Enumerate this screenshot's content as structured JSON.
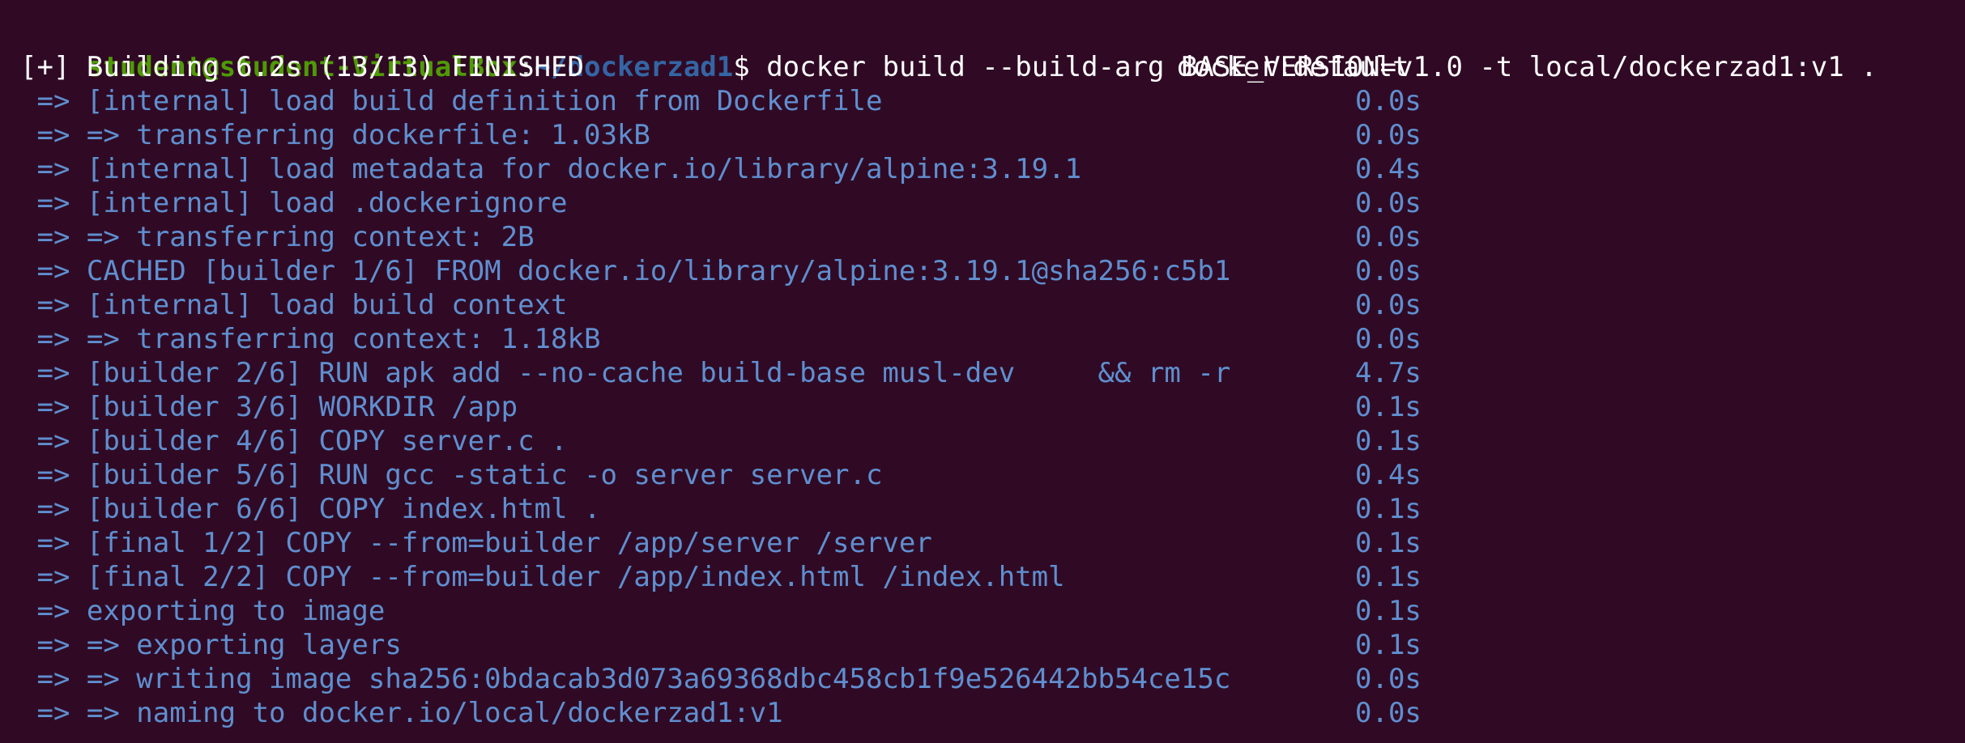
{
  "terminal": {
    "background": "#300a24",
    "prompt": {
      "user_host": "student@student-VirtualBox",
      "separator": ":",
      "path": "~/dockerzad1",
      "symbol": "$",
      "command": "docker build --build-arg BASE_VERSION=v1.0 -t local/dockerzad1:v1 ."
    },
    "header": {
      "status": "[+] Building 6.2s (13/13) FINISHED",
      "context": "docker:default"
    },
    "steps": [
      {
        "text": " => [internal] load build definition from Dockerfile",
        "time": "0.0s"
      },
      {
        "text": " => => transferring dockerfile: 1.03kB",
        "time": "0.0s"
      },
      {
        "text": " => [internal] load metadata for docker.io/library/alpine:3.19.1",
        "time": "0.4s"
      },
      {
        "text": " => [internal] load .dockerignore",
        "time": "0.0s"
      },
      {
        "text": " => => transferring context: 2B",
        "time": "0.0s"
      },
      {
        "text": " => CACHED [builder 1/6] FROM docker.io/library/alpine:3.19.1@sha256:c5b1",
        "time": "0.0s"
      },
      {
        "text": " => [internal] load build context",
        "time": "0.0s"
      },
      {
        "text": " => => transferring context: 1.18kB",
        "time": "0.0s"
      },
      {
        "text": " => [builder 2/6] RUN apk add --no-cache build-base musl-dev     && rm -r",
        "time": "4.7s"
      },
      {
        "text": " => [builder 3/6] WORKDIR /app",
        "time": "0.1s"
      },
      {
        "text": " => [builder 4/6] COPY server.c .",
        "time": "0.1s"
      },
      {
        "text": " => [builder 5/6] RUN gcc -static -o server server.c",
        "time": "0.4s"
      },
      {
        "text": " => [builder 6/6] COPY index.html .",
        "time": "0.1s"
      },
      {
        "text": " => [final 1/2] COPY --from=builder /app/server /server",
        "time": "0.1s"
      },
      {
        "text": " => [final 2/2] COPY --from=builder /app/index.html /index.html",
        "time": "0.1s"
      },
      {
        "text": " => exporting to image",
        "time": "0.1s"
      },
      {
        "text": " => => exporting layers",
        "time": "0.1s"
      },
      {
        "text": " => => writing image sha256:0bdacab3d073a69368dbc458cb1f9e526442bb54ce15c",
        "time": "0.0s"
      },
      {
        "text": " => => naming to docker.io/local/dockerzad1:v1",
        "time": "0.0s"
      }
    ]
  }
}
